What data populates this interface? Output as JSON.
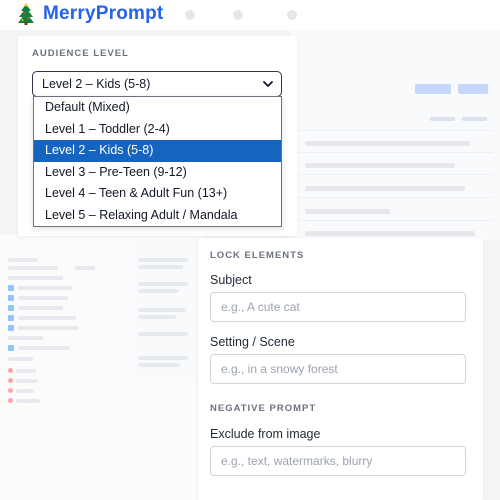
{
  "app": {
    "name": "MerryPrompt",
    "logo_icon": "tree-icon",
    "accent_color": "#2563eb"
  },
  "audience": {
    "section_title": "AUDIENCE LEVEL",
    "selected_value": "Level 2 – Kids (5-8)",
    "options": [
      "Default (Mixed)",
      "Level 1 – Toddler (2-4)",
      "Level 2 – Kids (5-8)",
      "Level 3 – Pre-Teen (9-12)",
      "Level 4 – Teen & Adult Fun (13+)",
      "Level 5 – Relaxing Adult / Mandala"
    ],
    "selected_index": 2,
    "selected_color": "#1565c0"
  },
  "lock_elements": {
    "section_title": "LOCK ELEMENTS",
    "subject_label": "Subject",
    "subject_placeholder": "e.g., A cute cat",
    "setting_label": "Setting / Scene",
    "setting_placeholder": "e.g., in a snowy forest"
  },
  "negative_prompt": {
    "section_title": "NEGATIVE PROMPT",
    "exclude_label": "Exclude from image",
    "exclude_placeholder": "e.g., text, watermarks, blurry"
  }
}
